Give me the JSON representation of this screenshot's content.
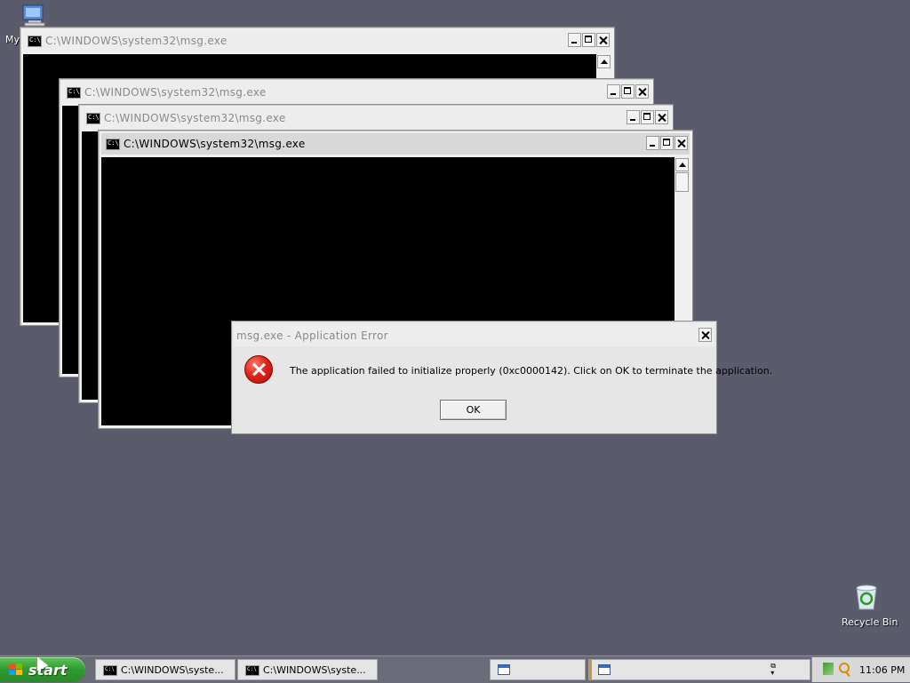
{
  "desktop": {
    "my_computer_label": "My",
    "recycle_bin_label": "Recycle Bin"
  },
  "console_windows": [
    {
      "title": "C:\\WINDOWS\\system32\\msg.exe",
      "icon_text": "C:\\"
    },
    {
      "title": "C:\\WINDOWS\\system32\\msg.exe",
      "icon_text": "C:\\"
    },
    {
      "title": "C:\\WINDOWS\\system32\\msg.exe",
      "icon_text": "C:\\"
    },
    {
      "title": "C:\\WINDOWS\\system32\\msg.exe",
      "icon_text": "C:\\"
    }
  ],
  "dialog": {
    "title": "msg.exe - Application Error",
    "message": "The application failed to initialize properly (0xc0000142). Click on OK to terminate the application.",
    "ok_label": "OK",
    "icon": "error-icon"
  },
  "taskbar": {
    "start_label": "start",
    "tasks": [
      {
        "label": "C:\\WINDOWS\\syste...",
        "icon_text": "C:\\"
      },
      {
        "label": "C:\\WINDOWS\\syste...",
        "icon_text": "C:\\"
      }
    ],
    "clock": "11:06 PM"
  },
  "colors": {
    "desktop_bg": "#5a5b6b",
    "start_green": "#2f9a2f",
    "error_red": "#e0241a"
  }
}
